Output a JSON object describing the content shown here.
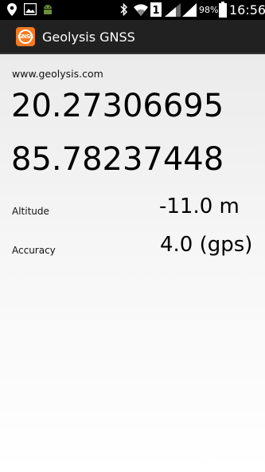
{
  "status_bar": {
    "battery": "98%",
    "time": "16:56",
    "icons": [
      "location-pin-icon",
      "image-icon",
      "android-icon",
      "bluetooth-icon",
      "wifi-icon",
      "sim-1-icon",
      "signal-icon",
      "battery-icon"
    ]
  },
  "app": {
    "title": "Geolysis GNSS",
    "logo_text": "GNSS",
    "accent_color": "#f47a20"
  },
  "main": {
    "website": "www.geolysis.com",
    "latitude": "20.27306695",
    "longitude": "85.78237448",
    "altitude": {
      "label": "Altitude",
      "value": "-11.0 m"
    },
    "accuracy": {
      "label": "Accuracy",
      "value": "4.0 (gps)"
    }
  }
}
